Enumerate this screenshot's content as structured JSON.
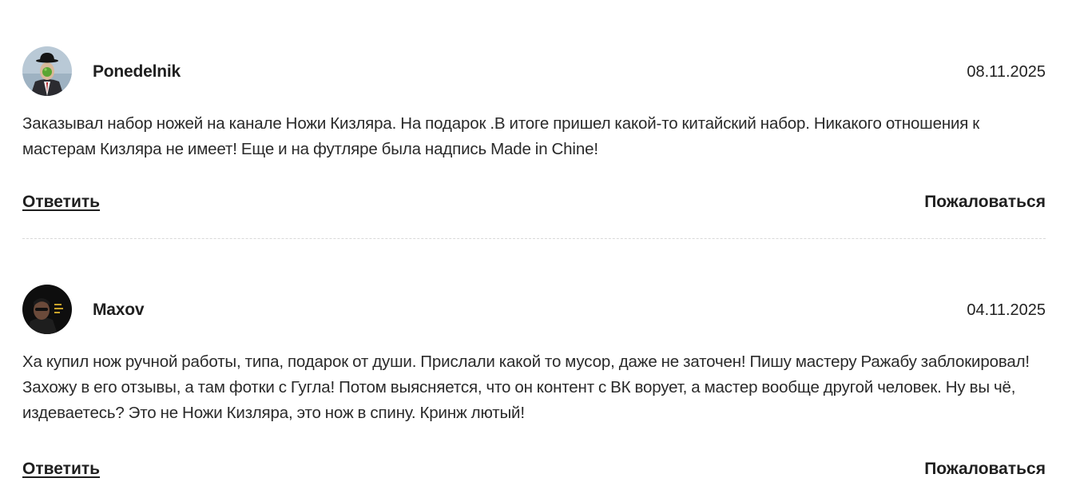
{
  "comments": [
    {
      "author": "Ponedelnik",
      "date": "08.11.2025",
      "text": "Заказывал набор ножей на канале Ножи Кизляра. На подарок .В итоге пришел какой-то китайский набор. Никакого отношения к мастерам Кизляра не имеет! Еще и на футляре была надпись Made in Chine!",
      "reply_label": "Ответить",
      "report_label": "Пожаловаться"
    },
    {
      "author": "Maxov",
      "date": "04.11.2025",
      "text": "Ха купил нож ручной работы, типа, подарок от души. Прислали какой то мусор, даже не заточен! Пишу мастеру Ражабу заблокировал! Захожу в его отзывы, а там фотки с Гугла! Потом выясняется, что он контент с ВК ворует, а мастер вообще другой человек. Ну вы чё, издеваетесь? Это не Ножи Кизляра, это нож в спину. Кринж лютый!",
      "reply_label": "Ответить",
      "report_label": "Пожаловаться"
    }
  ]
}
